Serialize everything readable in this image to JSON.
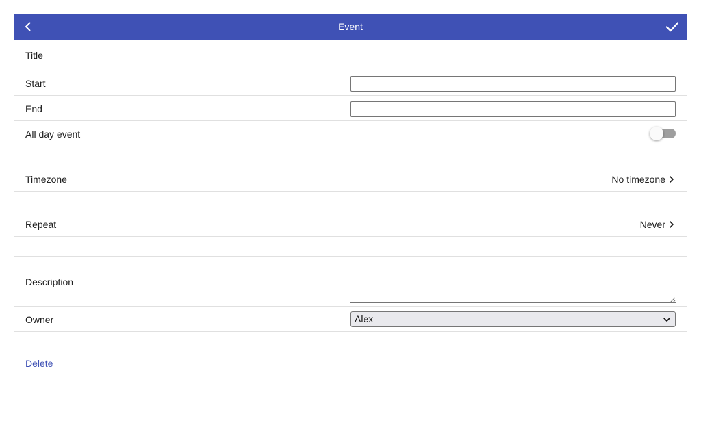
{
  "header": {
    "title": "Event",
    "back_icon": "chevron-left-icon",
    "save_icon": "check-icon",
    "background": "#3f51b5"
  },
  "form": {
    "title": {
      "label": "Title",
      "value": ""
    },
    "start": {
      "label": "Start",
      "value": ""
    },
    "end": {
      "label": "End",
      "value": ""
    },
    "all_day": {
      "label": "All day event",
      "checked": false
    },
    "timezone": {
      "label": "Timezone",
      "value": "No timezone"
    },
    "repeat": {
      "label": "Repeat",
      "value": "Never"
    },
    "description": {
      "label": "Description",
      "value": ""
    },
    "owner": {
      "label": "Owner",
      "selected": "Alex"
    }
  },
  "actions": {
    "delete_label": "Delete",
    "accent": "#3f51b5"
  }
}
